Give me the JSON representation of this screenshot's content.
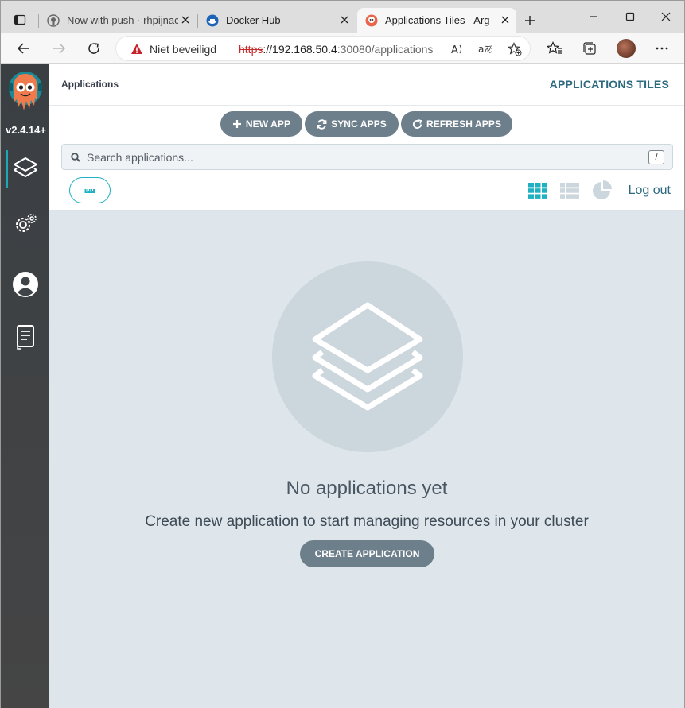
{
  "browser": {
    "tabs": [
      {
        "title": "Now with push · rhpijnacker",
        "active": false
      },
      {
        "title": "Docker Hub",
        "active": false
      },
      {
        "title": "Applications Tiles - Argo CD",
        "active": true
      }
    ],
    "security_label": "Niet beveiligd",
    "url": {
      "scheme": "https",
      "host": "://192.168.50.4",
      "path": ":30080/applications"
    }
  },
  "sidebar": {
    "version": "v2.4.14+",
    "items": [
      "applications",
      "settings",
      "user-info",
      "documentation"
    ]
  },
  "header": {
    "breadcrumb": "Applications",
    "title": "APPLICATIONS TILES"
  },
  "toolbar": {
    "new_app": "NEW APP",
    "sync_apps": "SYNC APPS",
    "refresh_apps": "REFRESH APPS"
  },
  "search": {
    "placeholder": "Search applications...",
    "value": "",
    "shortcut": "/"
  },
  "view": {
    "logout": "Log out",
    "selected": "tiles"
  },
  "empty_state": {
    "title": "No applications yet",
    "subtitle": "Create new application to start managing resources in your cluster",
    "button": "CREATE APPLICATION"
  },
  "colors": {
    "accent": "#1fb1c1",
    "pill": "#6d7f8b",
    "sidebar": "#404447",
    "content_bg": "#dee6eb"
  }
}
